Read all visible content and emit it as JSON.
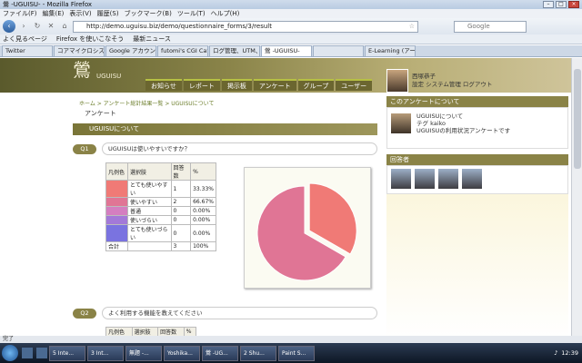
{
  "browser": {
    "title": "鶯 -UGUISU- - Mozilla Firefox",
    "menu": [
      "ファイル(F)",
      "編集(E)",
      "表示(V)",
      "履歴(S)",
      "ブックマーク(B)",
      "ツール(T)",
      "ヘルプ(H)"
    ],
    "url": "http://demo.uguisu.biz/demo/questionnaire_forms/3/result",
    "search_placeholder": "Google",
    "bookmarks": [
      "よく見るページ",
      "Firefox を使いこなそう",
      "最新ニュース"
    ],
    "tabs": [
      "Twitter",
      "コアマイクロシステ...",
      "Google アカウント",
      "futomi's CGI Cafe ...",
      "ログ管理、UTM、L...",
      "鶯 -UGUISU-",
      "",
      "E-Learning (アール..."
    ],
    "status": "完了"
  },
  "site": {
    "logo": "鶯",
    "logo_sub": "UGUISU",
    "nav": [
      "お知らせ",
      "レポート",
      "掲示板",
      "アンケート",
      "グループ",
      "ユーザー"
    ],
    "user_name": "西塚恭子",
    "user_links": "設定 システム管理 ログアウト",
    "breadcrumb": "ホーム > アンケート総計結果一覧 > UGUISUについて",
    "page_title": "アンケート",
    "section_title": "UGUISUについて"
  },
  "q1": {
    "badge": "Q1",
    "text": "UGUISUは使いやすいですか？",
    "headers": [
      "凡例色",
      "選択肢",
      "回答数",
      "%"
    ],
    "rows": [
      {
        "label": "とても使いやすい",
        "count": "1",
        "pct": "33.33%",
        "color": "#f07a76"
      },
      {
        "label": "使いやすい",
        "count": "2",
        "pct": "66.67%",
        "color": "#e07595"
      },
      {
        "label": "普通",
        "count": "0",
        "pct": "0.00%",
        "color": "#d47ec0"
      },
      {
        "label": "使いづらい",
        "count": "0",
        "pct": "0.00%",
        "color": "#a379d8"
      },
      {
        "label": "とても使いづらい",
        "count": "0",
        "pct": "0.00%",
        "color": "#7a73e0"
      }
    ],
    "total_label": "合計",
    "total_count": "3",
    "total_pct": "100%"
  },
  "q2": {
    "badge": "Q2",
    "text": "よく利用する機能を教えてください",
    "headers": [
      "凡例色",
      "選択肢",
      "回答数",
      "%"
    ]
  },
  "chart_data": {
    "type": "pie",
    "categories": [
      "とても使いやすい",
      "使いやすい",
      "普通",
      "使いづらい",
      "とても使いづらい"
    ],
    "values": [
      1,
      2,
      0,
      0,
      0
    ],
    "colors": [
      "#f07a76",
      "#e07595",
      "#d47ec0",
      "#a379d8",
      "#7a73e0"
    ]
  },
  "sidebar": {
    "about_title": "このアンケートについて",
    "about_name": "UGUISUについて",
    "about_by": "テグ kaiko",
    "about_desc": "UGUISUの利用状況アンケートです",
    "respondents_title": "回答者"
  },
  "taskbar": {
    "tasks": [
      "5 Inte...",
      "3 Int...",
      "無題 -...",
      "Yoshika...",
      "鶯 -UG...",
      "2 Shu...",
      "Paint S..."
    ],
    "time": "12:39"
  }
}
